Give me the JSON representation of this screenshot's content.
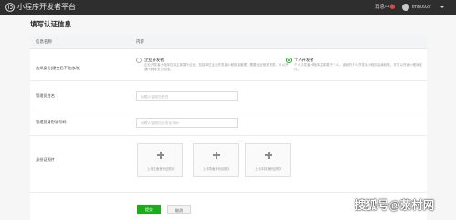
{
  "topbar": {
    "brand": "小程序开发者平台",
    "messages": "消息中心",
    "user": "lmh0927"
  },
  "page": {
    "title": "填写认证信息"
  },
  "table": {
    "col_name": "信息名称",
    "col_content": "内容"
  },
  "form": {
    "identity": {
      "label": "选择身份(提交后不能修改)",
      "options": [
        {
          "title": "企业开发者",
          "desc": "企业开发者小程序仅用主体属于企业。包括单位企业开发者小程序后管理，需要企业相关资质。可以开通小程序支付权限。",
          "selected": false
        },
        {
          "title": "个人开发者",
          "desc": "个人开发者小程序主体属于个人。适用的个人开发者小程序后续相关。开发以开通小程序支付。",
          "selected": true
        }
      ]
    },
    "name": {
      "label": "管理员姓名",
      "placeholder": "请输入管理员姓名",
      "value": ""
    },
    "id_number": {
      "label": "管理员身份证号码",
      "placeholder": "请输入管理员身份证号码",
      "value": ""
    },
    "id_photo": {
      "label": "身份证照片",
      "uploads": [
        "上传正面身份证照片",
        "上传背面身份证照片",
        "上传手持身份证照片"
      ]
    }
  },
  "actions": {
    "submit": "提交",
    "cancel": "取消"
  },
  "watermark": "搜狐号@荥村网",
  "colors": {
    "topbar": "#2e2e2e",
    "accent": "#1aad19",
    "badge": "#e64340"
  }
}
